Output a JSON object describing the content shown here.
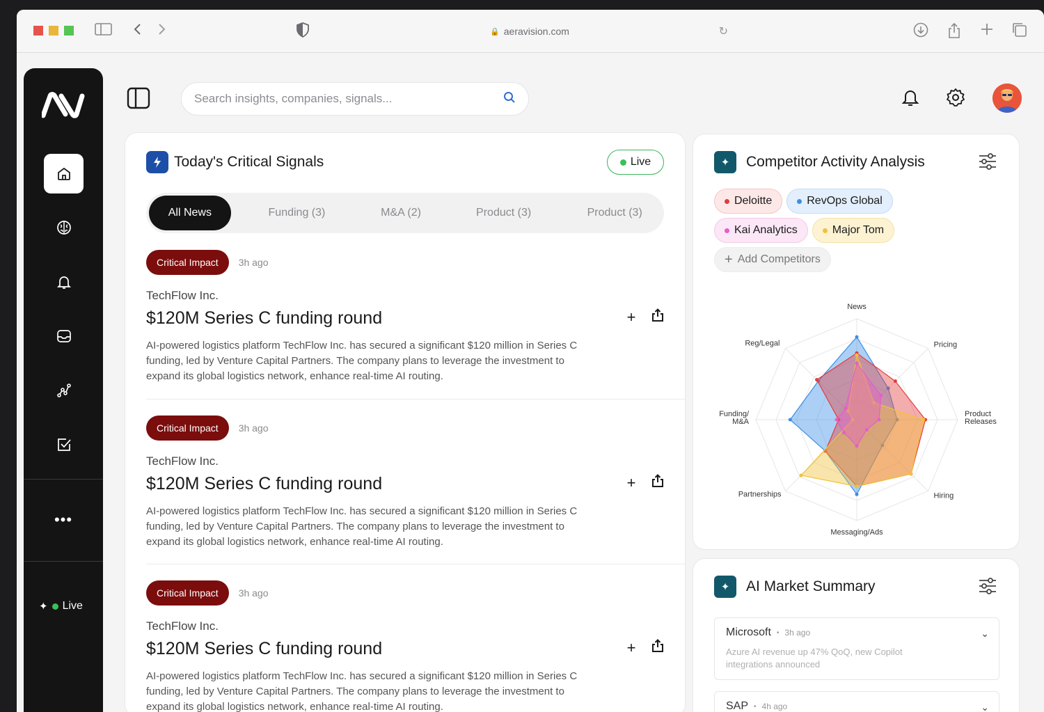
{
  "browser": {
    "url": "aeravision.com"
  },
  "sidebar": {
    "items": [
      {
        "name": "home",
        "icon": "home-icon",
        "active": true
      },
      {
        "name": "insights",
        "icon": "brain-icon"
      },
      {
        "name": "alerts",
        "icon": "bell-icon"
      },
      {
        "name": "inbox",
        "icon": "inbox-icon"
      },
      {
        "name": "analytics",
        "icon": "graph-icon"
      },
      {
        "name": "tasks",
        "icon": "checkbox-icon"
      }
    ],
    "more": "•••",
    "live_label": "Live"
  },
  "search": {
    "placeholder": "Search insights, companies, signals..."
  },
  "signals": {
    "title": "Today's Critical Signals",
    "live_label": "Live",
    "tabs": [
      "All News",
      "Funding (3)",
      "M&A (2)",
      "Product (3)",
      "Product (3)"
    ],
    "items": [
      {
        "badge": "Critical Impact",
        "time": "3h ago",
        "company": "TechFlow Inc.",
        "headline": "$120M Series C funding round",
        "body": "AI-powered logistics platform TechFlow Inc. has secured a significant $120 million in Series C funding, led by Venture Capital Partners. The company plans to leverage the investment to expand its global logistics network, enhance real-time AI routing."
      },
      {
        "badge": "Critical Impact",
        "time": "3h ago",
        "company": "TechFlow Inc.",
        "headline": "$120M Series C funding round",
        "body": "AI-powered logistics platform TechFlow Inc. has secured a significant $120 million in Series C funding, led by Venture Capital Partners. The company plans to leverage the investment to expand its global logistics network, enhance real-time AI routing."
      },
      {
        "badge": "Critical Impact",
        "time": "3h ago",
        "company": "TechFlow Inc.",
        "headline": "$120M Series C funding round",
        "body": "AI-powered logistics platform TechFlow Inc. has secured a significant $120 million in Series C funding, led by Venture Capital Partners. The company plans to leverage the investment to expand its global logistics network, enhance real-time AI routing."
      }
    ]
  },
  "competitor": {
    "title": "Competitor Activity Analysis",
    "competitors": [
      {
        "name": "Deloitte",
        "color": "#e53b3b"
      },
      {
        "name": "RevOps Global",
        "color": "#3a8ee6"
      },
      {
        "name": "Kai Analytics",
        "color": "#e45fc8"
      },
      {
        "name": "Major Tom",
        "color": "#f0c23a"
      }
    ],
    "add_label": "Add Competitors",
    "chart_data": {
      "type": "radar",
      "axes": [
        "News",
        "Pricing",
        "Product Releases",
        "Hiring",
        "Messaging/Ads",
        "Partnerships",
        "Funding/ M&A",
        "Reg/Legal"
      ],
      "rmax": 5,
      "series": [
        {
          "name": "RevOps Global",
          "color": "#3a8ee6",
          "values": [
            4.1,
            2.2,
            2.0,
            1.8,
            3.7,
            2.2,
            3.3,
            2.7
          ]
        },
        {
          "name": "Deloitte",
          "color": "#e53b3b",
          "values": [
            3.3,
            2.7,
            3.4,
            3.8,
            3.3,
            2.2,
            0.9,
            2.8
          ]
        },
        {
          "name": "Major Tom",
          "color": "#f0c23a",
          "values": [
            3.2,
            1.2,
            3.3,
            3.8,
            3.3,
            3.9,
            0.2,
            0.6
          ]
        },
        {
          "name": "Kai Analytics",
          "color": "#e45fc8",
          "values": [
            2.8,
            1.7,
            1.1,
            0.7,
            1.3,
            0.9,
            1.0,
            0.8
          ]
        }
      ]
    }
  },
  "market": {
    "title": "AI Market Summary",
    "cards": [
      {
        "company": "Microsoft",
        "time": "3h ago",
        "text": "Azure AI revenue up 47% QoQ, new Copilot integrations announced"
      },
      {
        "company": "SAP",
        "time": "4h ago",
        "text": ""
      }
    ]
  }
}
